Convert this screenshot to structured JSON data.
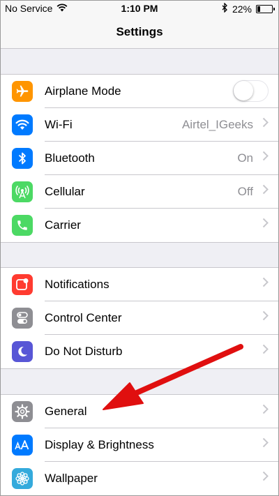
{
  "status_bar": {
    "carrier": "No Service",
    "time": "1:10 PM",
    "battery": "22%",
    "battery_level": 0.22
  },
  "nav": {
    "title": "Settings"
  },
  "groups": [
    {
      "items": [
        {
          "label": "Airplane Mode",
          "icon": "airplane-icon",
          "color": "#ff9500",
          "control": "toggle",
          "toggle_on": false
        },
        {
          "label": "Wi-Fi",
          "value": "Airtel_IGeeks",
          "icon": "wifi-icon",
          "color": "#007aff"
        },
        {
          "label": "Bluetooth",
          "value": "On",
          "icon": "bluetooth-icon",
          "color": "#007aff"
        },
        {
          "label": "Cellular",
          "value": "Off",
          "icon": "cellular-icon",
          "color": "#4cd964"
        },
        {
          "label": "Carrier",
          "value": "",
          "icon": "phone-icon",
          "color": "#4cd964"
        }
      ]
    },
    {
      "items": [
        {
          "label": "Notifications",
          "icon": "notifications-icon",
          "color": "#ff3b30"
        },
        {
          "label": "Control Center",
          "icon": "control-center-icon",
          "color": "#8e8e93"
        },
        {
          "label": "Do Not Disturb",
          "icon": "moon-icon",
          "color": "#5856d6"
        }
      ]
    },
    {
      "items": [
        {
          "label": "General",
          "icon": "gear-icon",
          "color": "#8e8e93"
        },
        {
          "label": "Display & Brightness",
          "icon": "text-size-icon",
          "color": "#007aff"
        },
        {
          "label": "Wallpaper",
          "icon": "flower-icon",
          "color": "#34aadc"
        }
      ]
    }
  ],
  "annotation": {
    "arrow_color": "#e00f0f",
    "points_to": "General"
  }
}
